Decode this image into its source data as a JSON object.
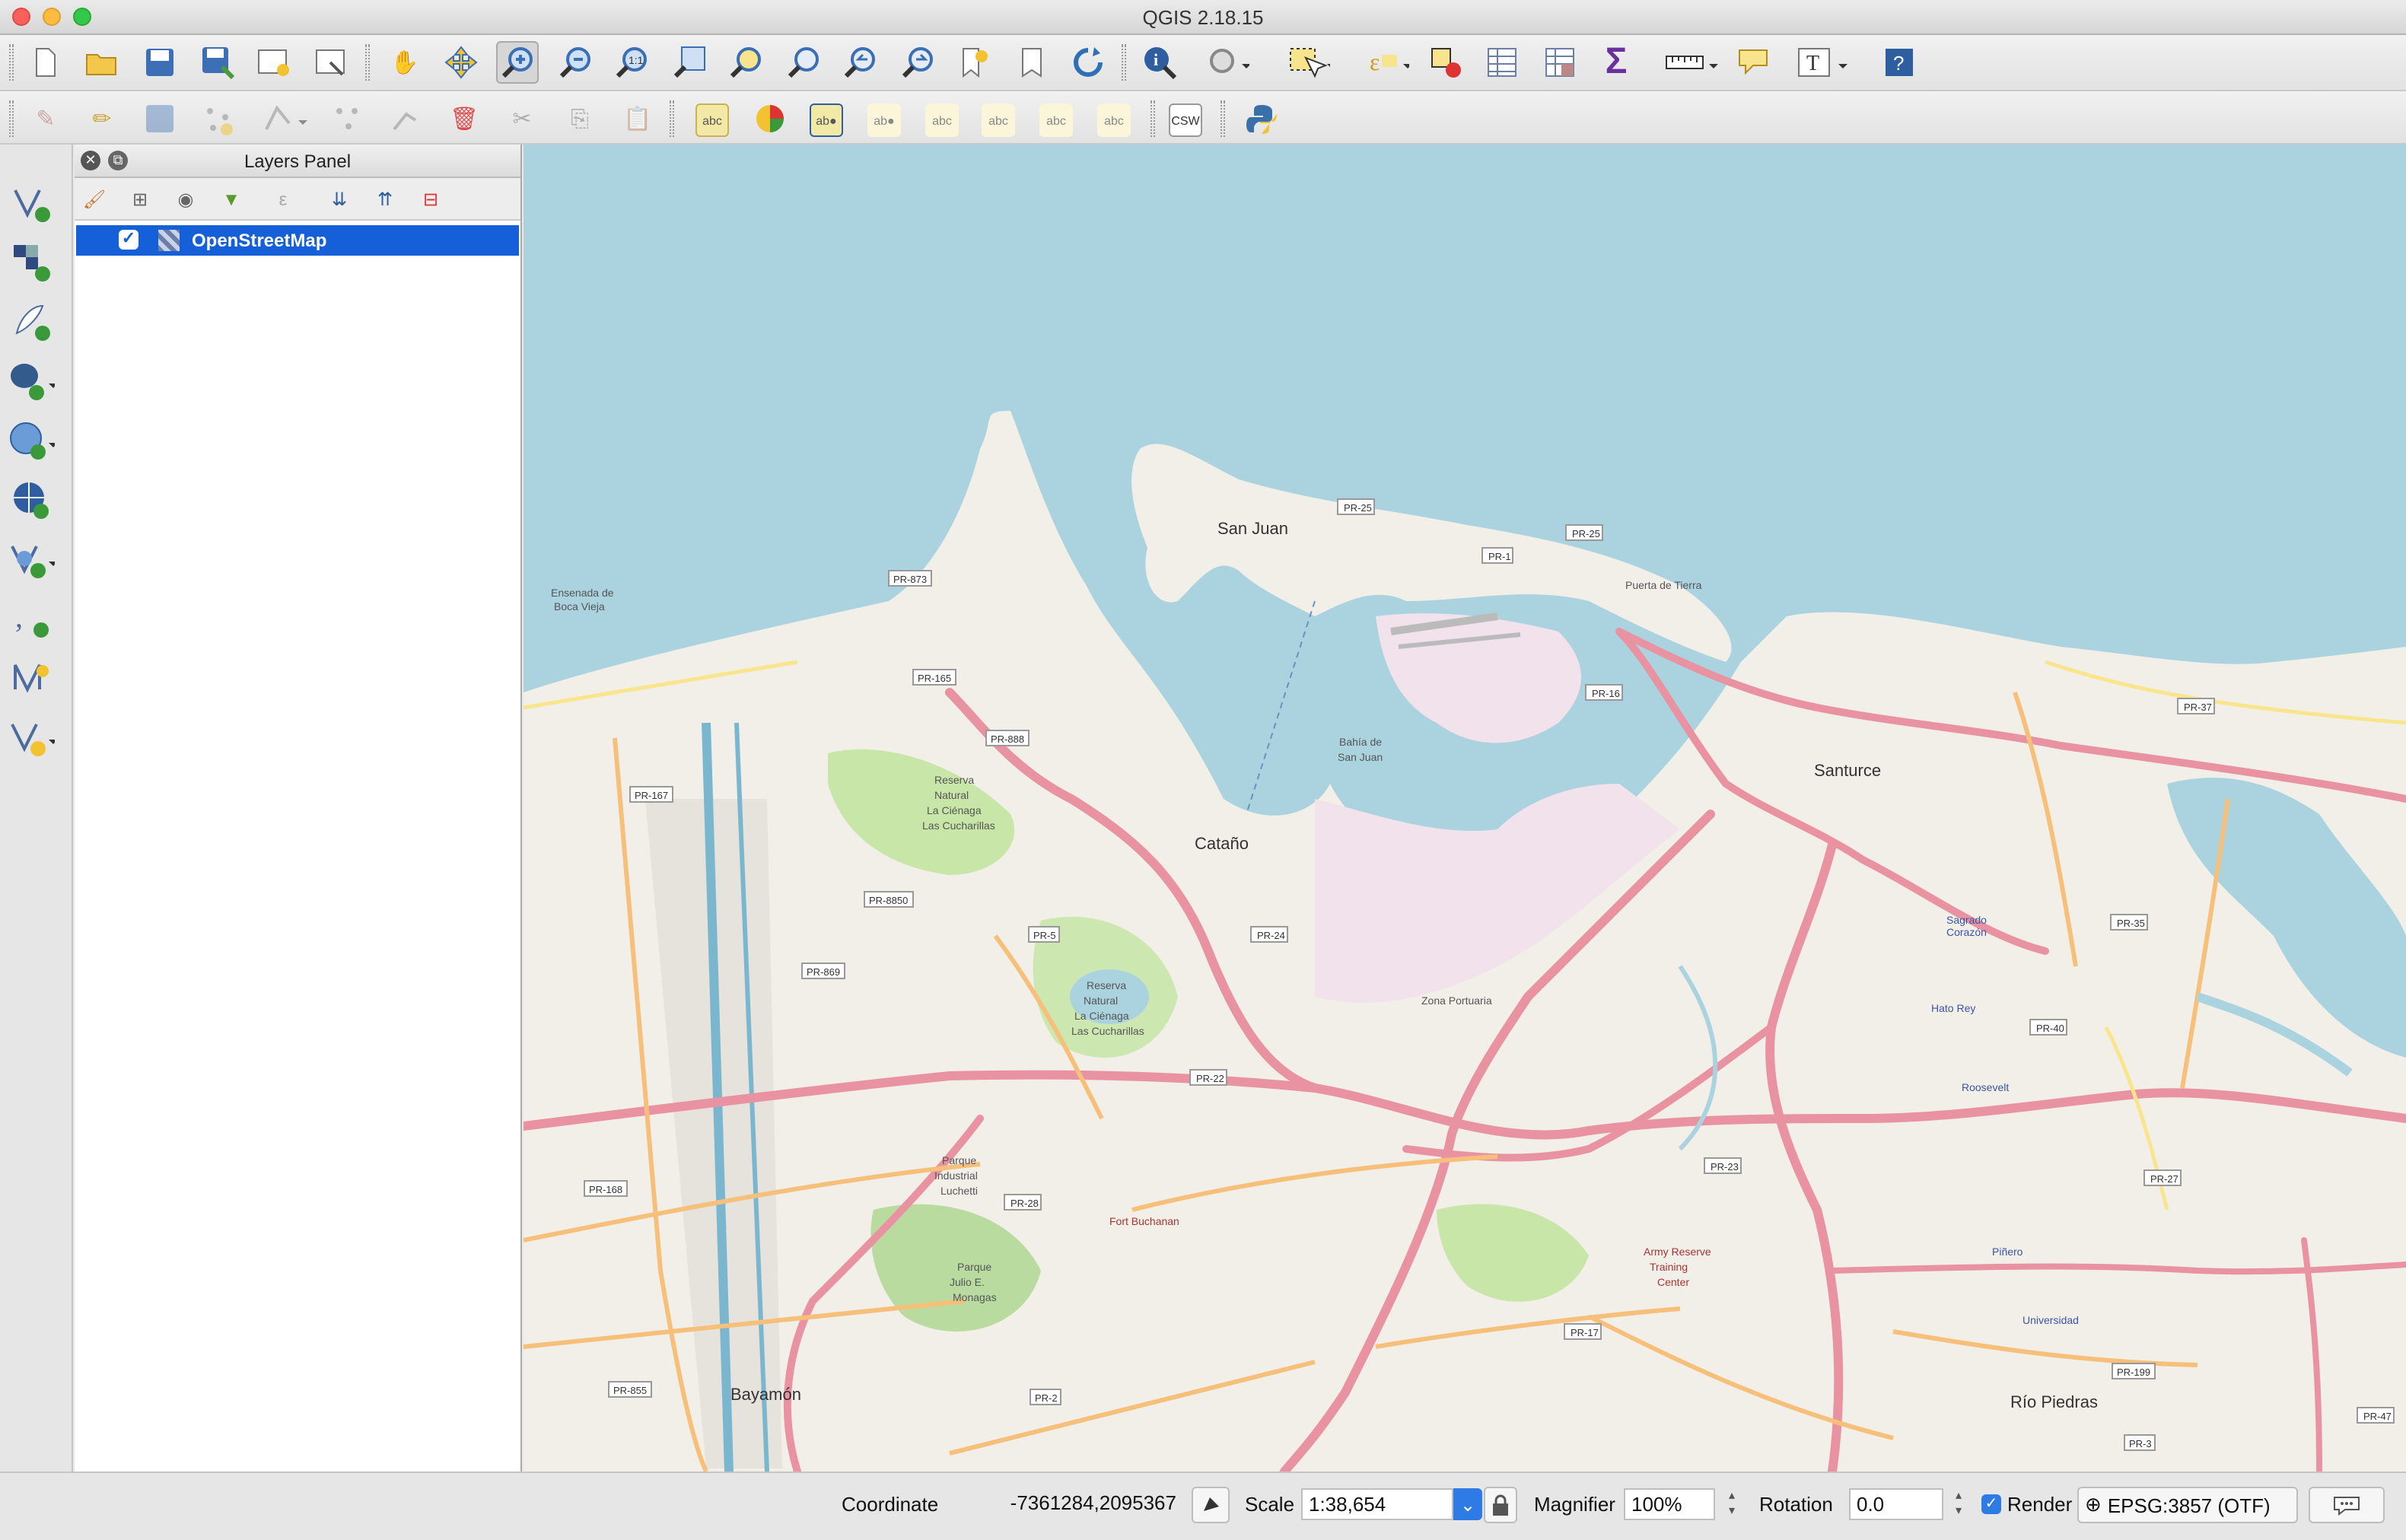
{
  "window": {
    "title": "QGIS 2.18.15"
  },
  "toolbar1": {
    "icons": [
      "new-project-icon",
      "open-project-icon",
      "save-project-icon",
      "save-as-icon",
      "new-print-composer-icon",
      "composer-manager-icon",
      "pan-map-icon",
      "pan-to-selection-icon",
      "zoom-in-icon",
      "zoom-out-icon",
      "zoom-actual-size-icon",
      "zoom-full-icon",
      "zoom-to-selection-icon",
      "zoom-to-layer-icon",
      "zoom-last-icon",
      "zoom-next-icon",
      "new-bookmark-icon",
      "show-bookmarks-icon",
      "refresh-icon",
      "identify-icon",
      "run-action-icon",
      "select-features-icon",
      "select-by-expression-icon",
      "deselect-all-icon",
      "attribute-table-icon",
      "field-calculator-icon",
      "statistical-summary-icon",
      "measure-icon",
      "map-tips-icon",
      "text-annotation-icon",
      "help-icon"
    ]
  },
  "toolbar2": {
    "csw_label": "CSW",
    "icons": [
      "current-edits-icon",
      "toggle-editing-icon",
      "save-layer-edits-icon",
      "add-feature-icon",
      "move-feature-icon",
      "node-tool-icon",
      "delete-selected-icon",
      "cut-features-icon",
      "copy-features-icon",
      "paste-features-icon",
      "label-icon",
      "diagram-icon",
      "pin-labels-icon",
      "highlight-pinned-icon",
      "show-hide-labels-icon",
      "move-label-icon",
      "rotate-label-icon",
      "change-label-icon",
      "python-console-icon"
    ]
  },
  "left_toolbar": {
    "icons": [
      "add-vector-layer-icon",
      "add-raster-layer-icon",
      "add-spatialite-layer-icon",
      "add-postgis-layer-icon",
      "add-wms-layer-icon",
      "add-wcs-layer-icon",
      "add-wfs-layer-icon",
      "add-delimited-text-layer-icon",
      "new-shapefile-layer-icon",
      "new-gpx-layer-icon"
    ]
  },
  "layers_panel": {
    "title": "Layers Panel",
    "layers": [
      {
        "name": "OpenStreetMap",
        "checked": true
      }
    ]
  },
  "map": {
    "cities": [
      "San Juan",
      "Cataño",
      "Santurce",
      "Bayamón",
      "Río Piedras"
    ],
    "places": [
      "Reserva Natural La Ciénaga Las Cucharillas",
      "Reserva Natural La Ciénaga Las Cucharillas",
      "Bahía de San Juan",
      "Zona Portuaria",
      "Parque Industrial Luchetti",
      "Fort Buchanan",
      "Army Reserve Training Center",
      "Parque Julio E. Monagas",
      "Universidad",
      "Piñero",
      "Roosevelt",
      "Hato Rey",
      "Sagrado Corazón",
      "Puerta de Tierra",
      "Ensenada de Boca Vieja"
    ],
    "roads": [
      "PR-25",
      "PR-1",
      "PR-16",
      "PR-37",
      "PR-873",
      "PR-165",
      "PR-888",
      "PR-167",
      "PR-5",
      "PR-8850",
      "PR-869",
      "PR-24",
      "PR-22",
      "PR-28",
      "PR-168",
      "PR-855",
      "PR-2",
      "PR-23",
      "PR-17",
      "PR-27",
      "PR-35",
      "PR-40",
      "PR-3",
      "PR-199",
      "PR-47"
    ]
  },
  "status": {
    "coordinate_label": "Coordinate",
    "coordinate_value": "-7361284,2095367",
    "scale_label": "Scale",
    "scale_value": "1:38,654",
    "magnifier_label": "Magnifier",
    "magnifier_value": "100%",
    "rotation_label": "Rotation",
    "rotation_value": "0.0",
    "render_label": "Render",
    "render_checked": true,
    "crs_label": "EPSG:3857 (OTF)"
  }
}
